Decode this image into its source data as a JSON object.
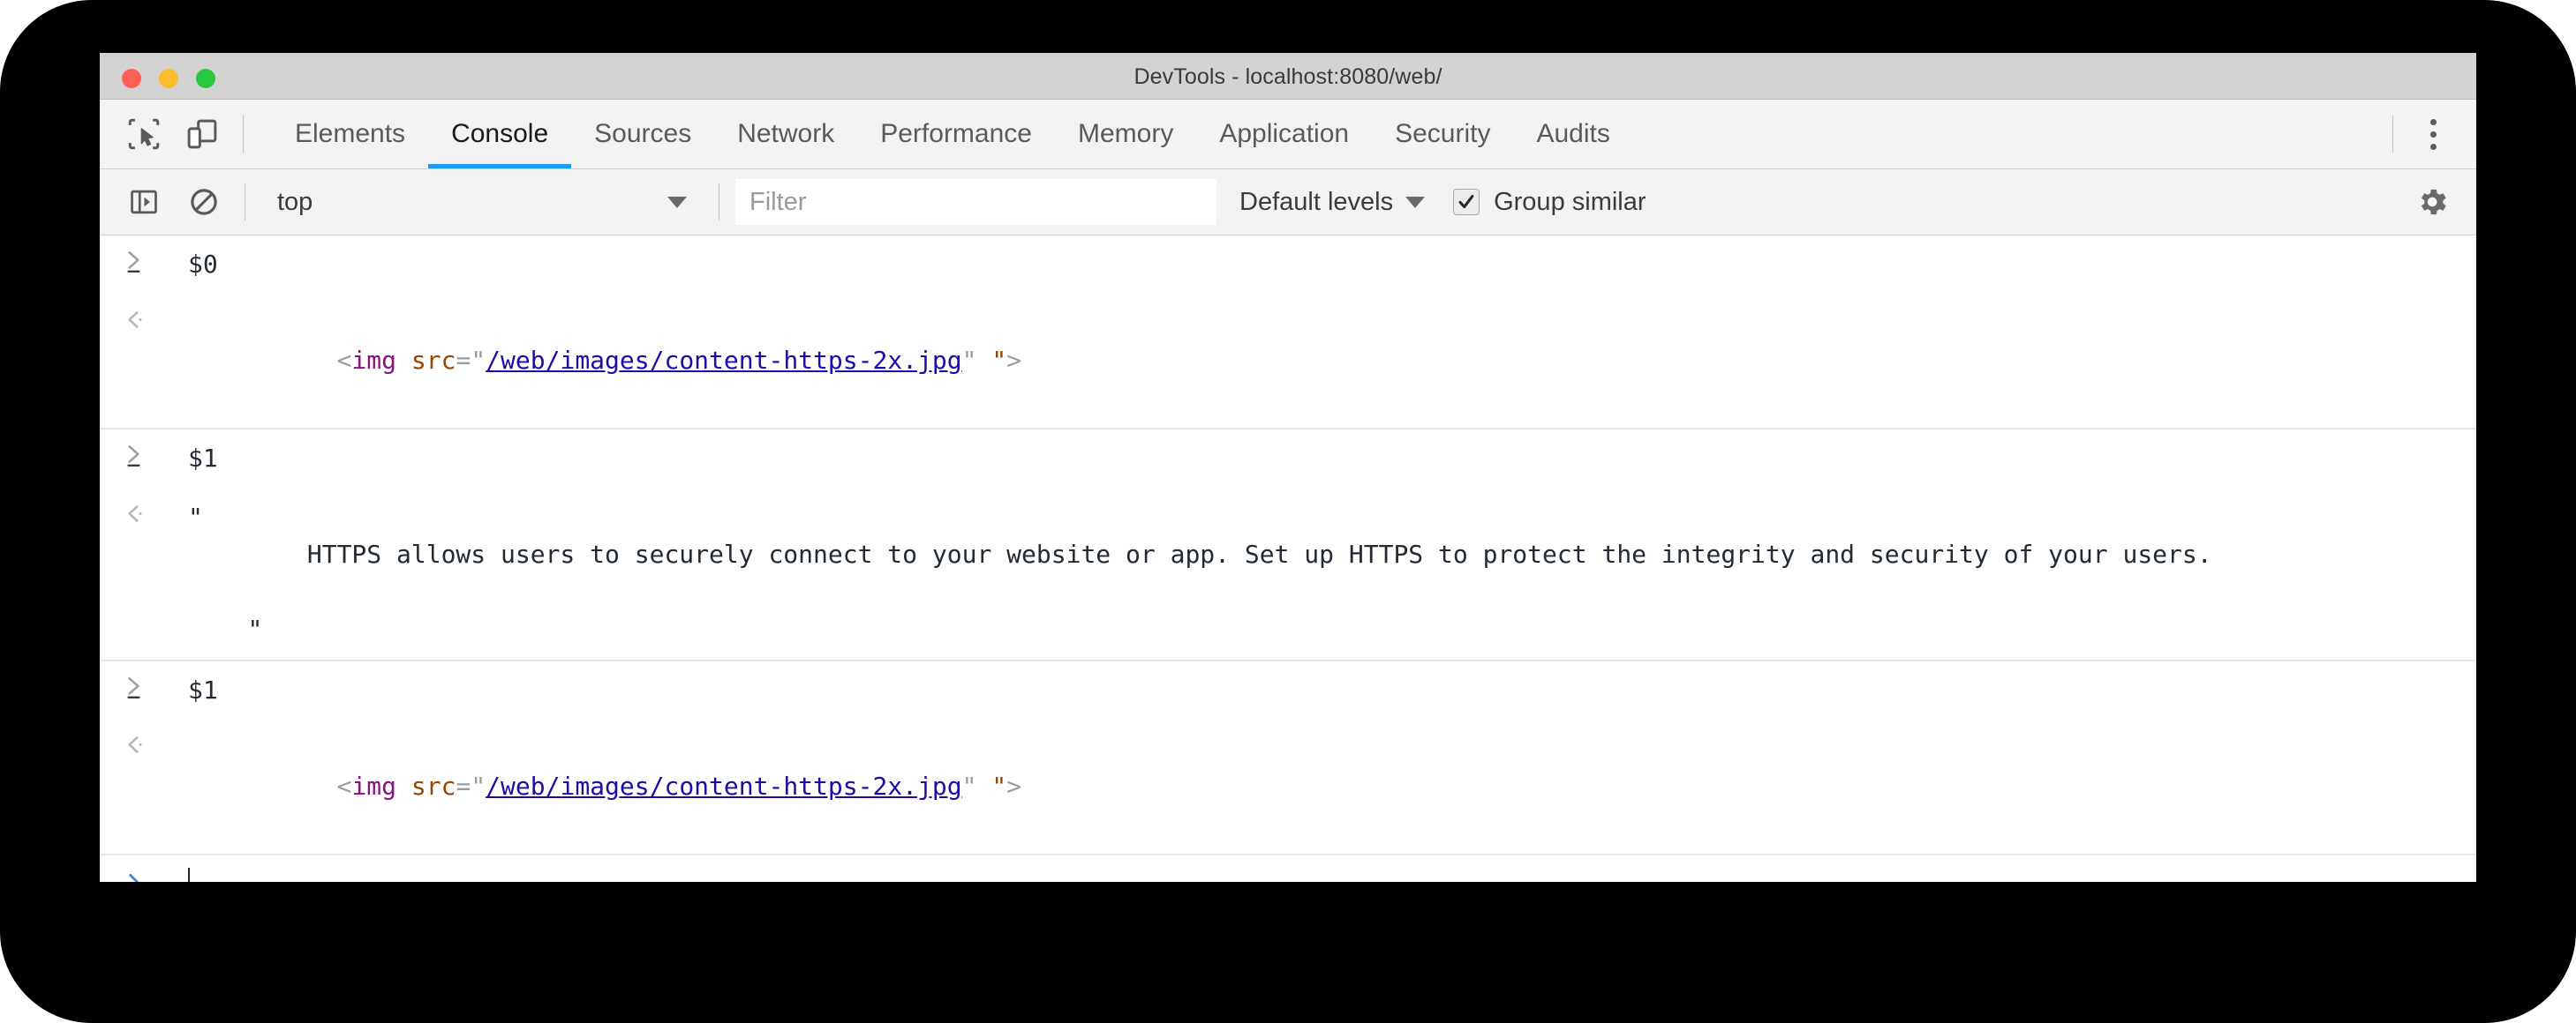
{
  "window": {
    "title": "DevTools - localhost:8080/web/",
    "traffic_lights": [
      {
        "name": "close",
        "color": "#ff5f57"
      },
      {
        "name": "minimize",
        "color": "#febc2e"
      },
      {
        "name": "maximize",
        "color": "#28c840"
      }
    ]
  },
  "toolbar_icons": {
    "inspect": "inspect-element-icon",
    "device": "device-toolbar-icon",
    "kebab": "more-options-icon"
  },
  "tabs": [
    {
      "label": "Elements",
      "active": false
    },
    {
      "label": "Console",
      "active": true
    },
    {
      "label": "Sources",
      "active": false
    },
    {
      "label": "Network",
      "active": false
    },
    {
      "label": "Performance",
      "active": false
    },
    {
      "label": "Memory",
      "active": false
    },
    {
      "label": "Application",
      "active": false
    },
    {
      "label": "Security",
      "active": false
    },
    {
      "label": "Audits",
      "active": false
    }
  ],
  "console_toolbar": {
    "sidebar_toggle": "console-sidebar-icon",
    "clear_console": "clear-console-icon",
    "context": "top",
    "filter_placeholder": "Filter",
    "filter_value": "",
    "levels": "Default levels",
    "group_similar_label": "Group similar",
    "group_similar_checked": true,
    "settings": "settings-gear-icon"
  },
  "console_rows": [
    {
      "kind": "input",
      "marker": ">",
      "text": "$0"
    },
    {
      "kind": "output",
      "marker": "<",
      "tokens": [
        {
          "t": "punct",
          "v": "<"
        },
        {
          "t": "tag",
          "v": "img"
        },
        {
          "t": "punct",
          "v": " "
        },
        {
          "t": "attr",
          "v": "src"
        },
        {
          "t": "punct",
          "v": "="
        },
        {
          "t": "punct",
          "v": "\""
        },
        {
          "t": "link",
          "v": "/web/images/content-https-2x.jpg"
        },
        {
          "t": "punct",
          "v": "\""
        },
        {
          "t": "punct",
          "v": " "
        },
        {
          "t": "attr",
          "v": "\""
        },
        {
          "t": "punct",
          "v": ">"
        }
      ]
    },
    {
      "kind": "input",
      "marker": ">",
      "text": "$1"
    },
    {
      "kind": "output",
      "marker": "<",
      "string_value": "\"\n        HTTPS allows users to securely connect to your website or app. Set up HTTPS to protect the integrity and security of your users.\n\n    \""
    },
    {
      "kind": "input",
      "marker": ">",
      "text": "$1"
    },
    {
      "kind": "output",
      "marker": "<",
      "tokens": [
        {
          "t": "punct",
          "v": "<"
        },
        {
          "t": "tag",
          "v": "img"
        },
        {
          "t": "punct",
          "v": " "
        },
        {
          "t": "attr",
          "v": "src"
        },
        {
          "t": "punct",
          "v": "="
        },
        {
          "t": "punct",
          "v": "\""
        },
        {
          "t": "link",
          "v": "/web/images/content-https-2x.jpg"
        },
        {
          "t": "punct",
          "v": "\""
        },
        {
          "t": "punct",
          "v": " "
        },
        {
          "t": "attr",
          "v": "\""
        },
        {
          "t": "punct",
          "v": ">"
        }
      ]
    }
  ],
  "prompt": {
    "marker": ">",
    "value": ""
  },
  "colors": {
    "accent": "#1a9bf0",
    "tag": "#881280",
    "attribute": "#994500",
    "link": "#1a0dab",
    "punct": "#9b9b9b",
    "text": "#232a33",
    "titlebar": "#d3d3d3",
    "toolbar": "#f3f3f3"
  }
}
